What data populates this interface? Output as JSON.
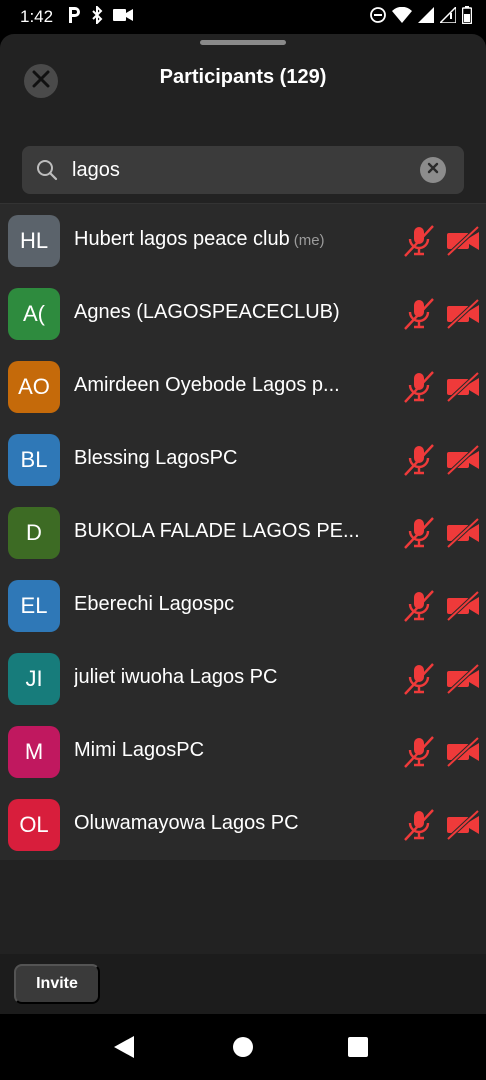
{
  "status_bar": {
    "time": "1:42",
    "left_icons": [
      "parking-p-icon",
      "bluetooth-icon",
      "video-camera-icon"
    ],
    "right_icons": [
      "do-not-disturb-icon",
      "wifi-icon",
      "cell-signal-icon",
      "cell-signal-icon",
      "battery-icon"
    ]
  },
  "header": {
    "title": "Participants (129)",
    "close_icon": "close-icon"
  },
  "search": {
    "value": "lagos",
    "icon": "search-icon",
    "clear_icon": "clear-icon"
  },
  "participants": [
    {
      "initials": "HL",
      "name": "Hubert lagos peace club",
      "tag": "(me)",
      "color": "#5b636b"
    },
    {
      "initials": "A(",
      "name": "Agnes (LAGOSPEACECLUB)",
      "tag": "",
      "color": "#2e8b3e"
    },
    {
      "initials": "AO",
      "name": "Amirdeen Oyebode Lagos p...",
      "tag": "",
      "color": "#c56a0a"
    },
    {
      "initials": "BL",
      "name": "Blessing LagosPC",
      "tag": "",
      "color": "#2f78b7"
    },
    {
      "initials": "D",
      "name": "BUKOLA FALADE LAGOS PE...",
      "tag": "",
      "color": "#3d6b24"
    },
    {
      "initials": "EL",
      "name": "Eberechi Lagospc",
      "tag": "",
      "color": "#2f78b7"
    },
    {
      "initials": "JI",
      "name": "juliet iwuoha Lagos PC",
      "tag": "",
      "color": "#177c7b"
    },
    {
      "initials": "M",
      "name": "Mimi LagosPC",
      "tag": "",
      "color": "#c0185f"
    },
    {
      "initials": "OL",
      "name": "Oluwamayowa Lagos PC",
      "tag": "",
      "color": "#d81e3c"
    }
  ],
  "muted_color": "#ef3a3a",
  "footer": {
    "invite_label": "Invite"
  },
  "nav": {
    "back_icon": "back-icon",
    "home_icon": "home-icon",
    "recents_icon": "recents-icon"
  }
}
